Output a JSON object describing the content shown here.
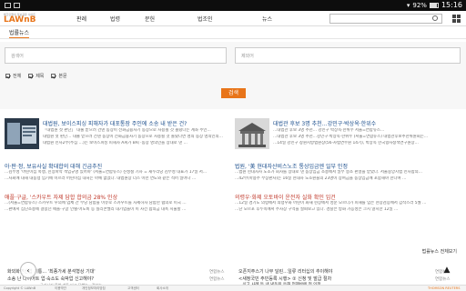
{
  "status": {
    "battery": "92%",
    "time": "15:16"
  },
  "logo": {
    "small": "법조인들의 정보공유 사이트",
    "big": "LAWnB"
  },
  "nav": [
    "판례",
    "법령",
    "문헌",
    "법조인",
    "뉴스"
  ],
  "tab": "법률뉴스",
  "search": {
    "placeholder_left": "검색어",
    "placeholder_right": "제외어",
    "button": "검색"
  },
  "filters": [
    "전체",
    "제목",
    "본문"
  ],
  "articles": [
    {
      "title": "대법원, 보이스피싱 피해자가 대포통장 주인에 소송 내 받은 건?",
      "body": [
        "「대법원 첫 판단」 대출 받으려 건넨 통장이 전화금융사기 통장으로 사용될 것 몰랐다는 계좌 주인…",
        "대법원 첫 판단… 대출 받으려 건넨 통장이 전화금융사기 통장으로 사용될 것 몰랐다면 명의 통장 명의인의…",
        "대법원 민사2부(주심 …)는 보이스피싱 피해자 A씨가 B씨 ·통장 명의인을 상대로 낸 …"
      ]
    },
    {
      "title": "대법관 후보 3명 추천…강민구·박상옥·한위수",
      "body": [
        "…대법관 후보 3명 추천… 강민구 박상옥·한위수 서울=연합뉴스…",
        "…대법관 후보 3명 추천…강민구·박상옥·한위수 (서울=연합뉴스) 대법관후보추천위원회는…",
        "…14일 강민구 창원지방법원장(56·사법연수원 14기), 박상옥 한국형사정책연구원장…"
      ]
    },
    {
      "title": "아·판·정, 보유사실 확대합의 대해 긴급추진",
      "body": [
        "…김부성 '어린이집 폭행, 진상파악 책임규명 있어야' (서울=연합뉴스) 진성철 기자 = 새누리당 김부성 대표가 17일 서…",
        "…사회에 대해 대통령 임기에 이르러 어린이집 대처는 아예 없었다. 대법원장 더스 이런 연도와 같은 적어 일어나 …"
      ]
    },
    {
      "title": "법원, '美 현대자산비스노조 통상임금엔 일부 인정",
      "body": [
        "…법원 현대자사 노조가 회사를 상대로 낸 통상임금 소송에서 일부 승소 판결을 받았다. 서울중앙지법 민사합의…",
        "…42부(마용주 부장판사)는 16일 현대자 노조원들의 23명이 상여금을 통상임금에 포함해야 한다며 …"
      ]
    },
    {
      "title": "애플·구글, '스카우트 자제 담합 합의금 28% 인상",
      "body": [
        "…(서울=연합뉴스) 스카우트 우의에 업체 간 부당 담합을 이유로 스카우트를 자제하자 담합한 혐의로 미국 …",
        "…판에서 집단소송에 걸렸던 애플·구글 인텔·어도비 등 실리콘밸리 대기업들이 이 사건 합의금 대폭 지불할 …"
      ]
    },
    {
      "title": "의령우·화제 오토바이 운전자 실화 확인 임건",
      "body": [
        "…12일 경기도 의령에서 의령우화 어린이 화재 현장에서 영문 모르다가 피해를 입은 현장검증에서 갑작스러 5월 …",
        "…난 모르포 후두쪽에서 주차장 구역을 살펴보고 있다. 경찰은 방화 가능성은 크지 않지만 12일 …"
      ]
    }
  ],
  "more": "법률뉴스 전체보기",
  "list": [
    {
      "title": "화외화면산업 기통... '최종가세 분석형상 기대'",
      "src": "연합뉴스"
    },
    {
      "title": "소송 난 다이어트 업·숙소도 숙박업 신고해야?",
      "src": "연합뉴스"
    },
    {
      "title": "…국가사기 불법 개통 다고 당했는…정부는 …",
      "src": "연합뉴스"
    },
    {
      "title": "오픈지주스기 나무 달린…일류 리터십의 추이해야",
      "src": "연합뉴스"
    },
    {
      "title": "<새정국민 주민등록 시행> ② 신청 및 발급 절차",
      "src": "연합뉴스"
    },
    {
      "title": "…신고 사례 등 낸 냉동된 유해 언제바에 첫 인정",
      "src": "연합뉴스"
    }
  ],
  "footer": {
    "copyright": "Copyright © LAWnB",
    "links": [
      "이용약관",
      "개인정보처리방침",
      "고객센터",
      "회사소개"
    ],
    "brand": "THOMSON REUTERS"
  }
}
